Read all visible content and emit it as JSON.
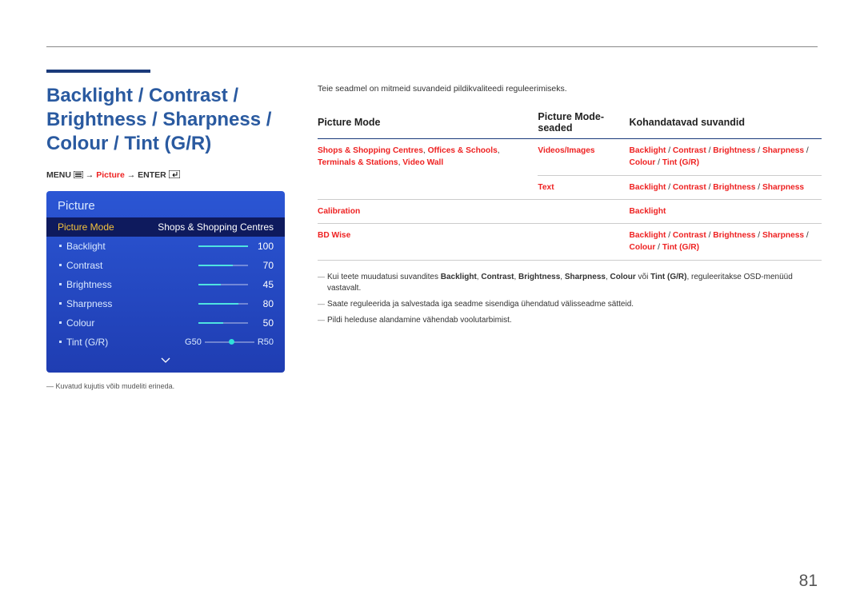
{
  "title": "Backlight / Contrast / Brightness / Sharpness / Colour / Tint (G/R)",
  "nav": {
    "menu": "MENU",
    "arrow1": "→",
    "mid": "Picture",
    "arrow2": "→",
    "enter": "ENTER"
  },
  "osd": {
    "header": "Picture",
    "mode_label": "Picture Mode",
    "mode_value": "Shops & Shopping Centres",
    "rows": [
      {
        "label": "Backlight",
        "value": 100,
        "fill": 100
      },
      {
        "label": "Contrast",
        "value": 70,
        "fill": 70
      },
      {
        "label": "Brightness",
        "value": 45,
        "fill": 45
      },
      {
        "label": "Sharpness",
        "value": 80,
        "fill": 80
      },
      {
        "label": "Colour",
        "value": 50,
        "fill": 50
      }
    ],
    "tint": {
      "label": "Tint (G/R)",
      "left": "G50",
      "right": "R50",
      "pos": 50
    }
  },
  "footnote": "Kuvatud kujutis võib mudeliti erineda.",
  "intro": "Teie seadmel on mitmeid suvandeid pildikvaliteedi reguleerimiseks.",
  "headers": {
    "mode": "Picture Mode",
    "seaded": "Picture Mode-seaded",
    "suvandid": "Kohandatavad suvandid"
  },
  "tbl": [
    {
      "mode": [
        "Shops & Shopping Centres",
        "Offices & Schools",
        "Terminals & Stations",
        "Video Wall"
      ],
      "mode_sep": ", ",
      "seaded": "Videos/Images",
      "suvandid": [
        "Backlight",
        "Contrast",
        "Brightness",
        "Sharpness",
        "Colour",
        "Tint (G/R)"
      ]
    },
    {
      "mode": null,
      "seaded": "Text",
      "suvandid": [
        "Backlight",
        "Contrast",
        "Brightness",
        "Sharpness"
      ]
    },
    {
      "mode": "Calibration",
      "seaded": "",
      "suvandid": [
        "Backlight"
      ]
    },
    {
      "mode": "BD Wise",
      "seaded": "",
      "suvandid": [
        "Backlight",
        "Contrast",
        "Brightness",
        "Sharpness",
        "Colour",
        "Tint (G/R)"
      ]
    }
  ],
  "notes": [
    {
      "text_pre": "Kui teete muudatusi suvandites ",
      "bolds": [
        "Backlight",
        "Contrast",
        "Brightness",
        "Sharpness",
        "Colour"
      ],
      "sep": ", ",
      "or": " või ",
      "last_bold": "Tint (G/R)",
      "text_post": ", reguleeritakse OSD-menüüd vastavalt."
    },
    {
      "text_plain": "Saate reguleerida ja salvestada iga seadme sisendiga ühendatud välisseadme sätteid."
    },
    {
      "text_plain": "Pildi heleduse alandamine vähendab voolutarbimist."
    }
  ],
  "page_number": "81"
}
